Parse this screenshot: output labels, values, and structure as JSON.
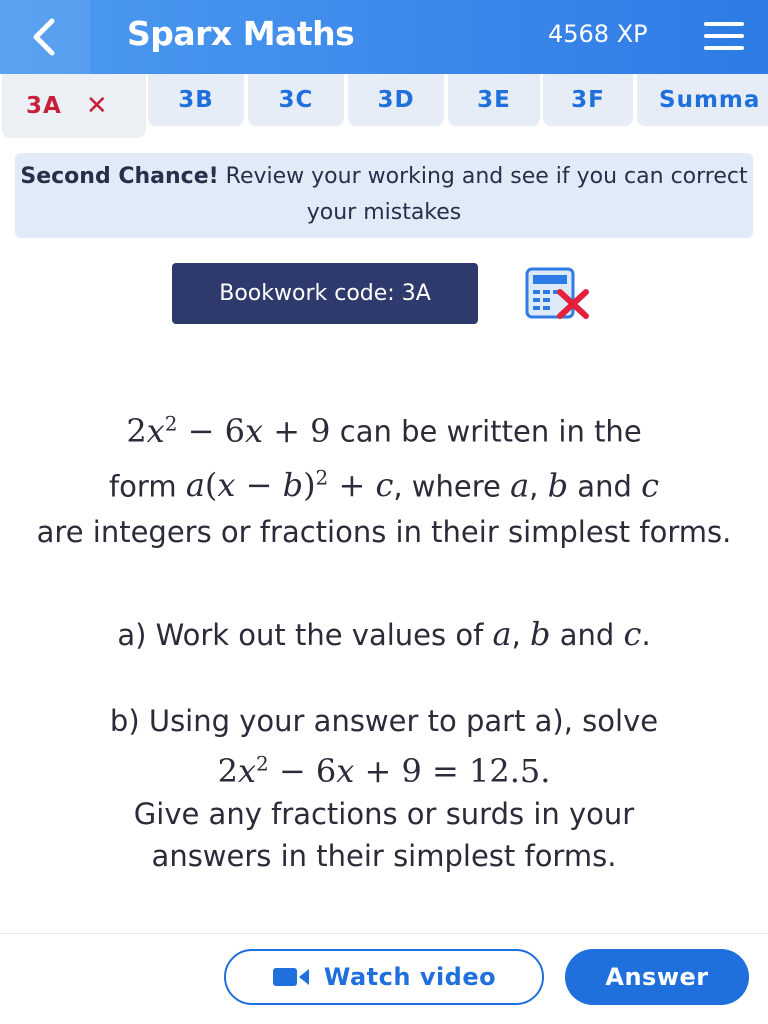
{
  "header": {
    "title": "Sparx Maths",
    "xp": "4568 XP",
    "back_icon": "chevron-left-icon",
    "menu_icon": "hamburger-menu-icon"
  },
  "tabs": [
    {
      "label": "3A",
      "active": true
    },
    {
      "label": "3B"
    },
    {
      "label": "3C"
    },
    {
      "label": "3D"
    },
    {
      "label": "3E"
    },
    {
      "label": "3F"
    },
    {
      "label": "Summa"
    }
  ],
  "tab_close": "✕",
  "banner": {
    "bold": "Second Chance!",
    "text": " Review your working and see if you can correct your mistakes"
  },
  "bookwork": "Bookwork code: 3A",
  "calculator_icon": "calculator-not-allowed-icon",
  "question": {
    "intro_text1": " can be written in the",
    "intro_text2": "form ",
    "intro_text3": ", where ",
    "intro_text4": " and ",
    "intro_text5": "are integers or fractions in their simplest forms.",
    "part_a_prefix": "a) Work out the values of ",
    "part_a_suffix": ".",
    "part_b_line1": "b) Using your answer to part a), solve",
    "part_b_line3": "Give any fractions or surds in your answers in their simplest forms."
  },
  "buttons": {
    "watch_video": "Watch video",
    "answer": "Answer"
  },
  "colors": {
    "header": "#2f7be6",
    "accent": "#1f6fdc",
    "active_tab_text": "#c6203a",
    "bookwork_bg": "#2e3a6b"
  }
}
